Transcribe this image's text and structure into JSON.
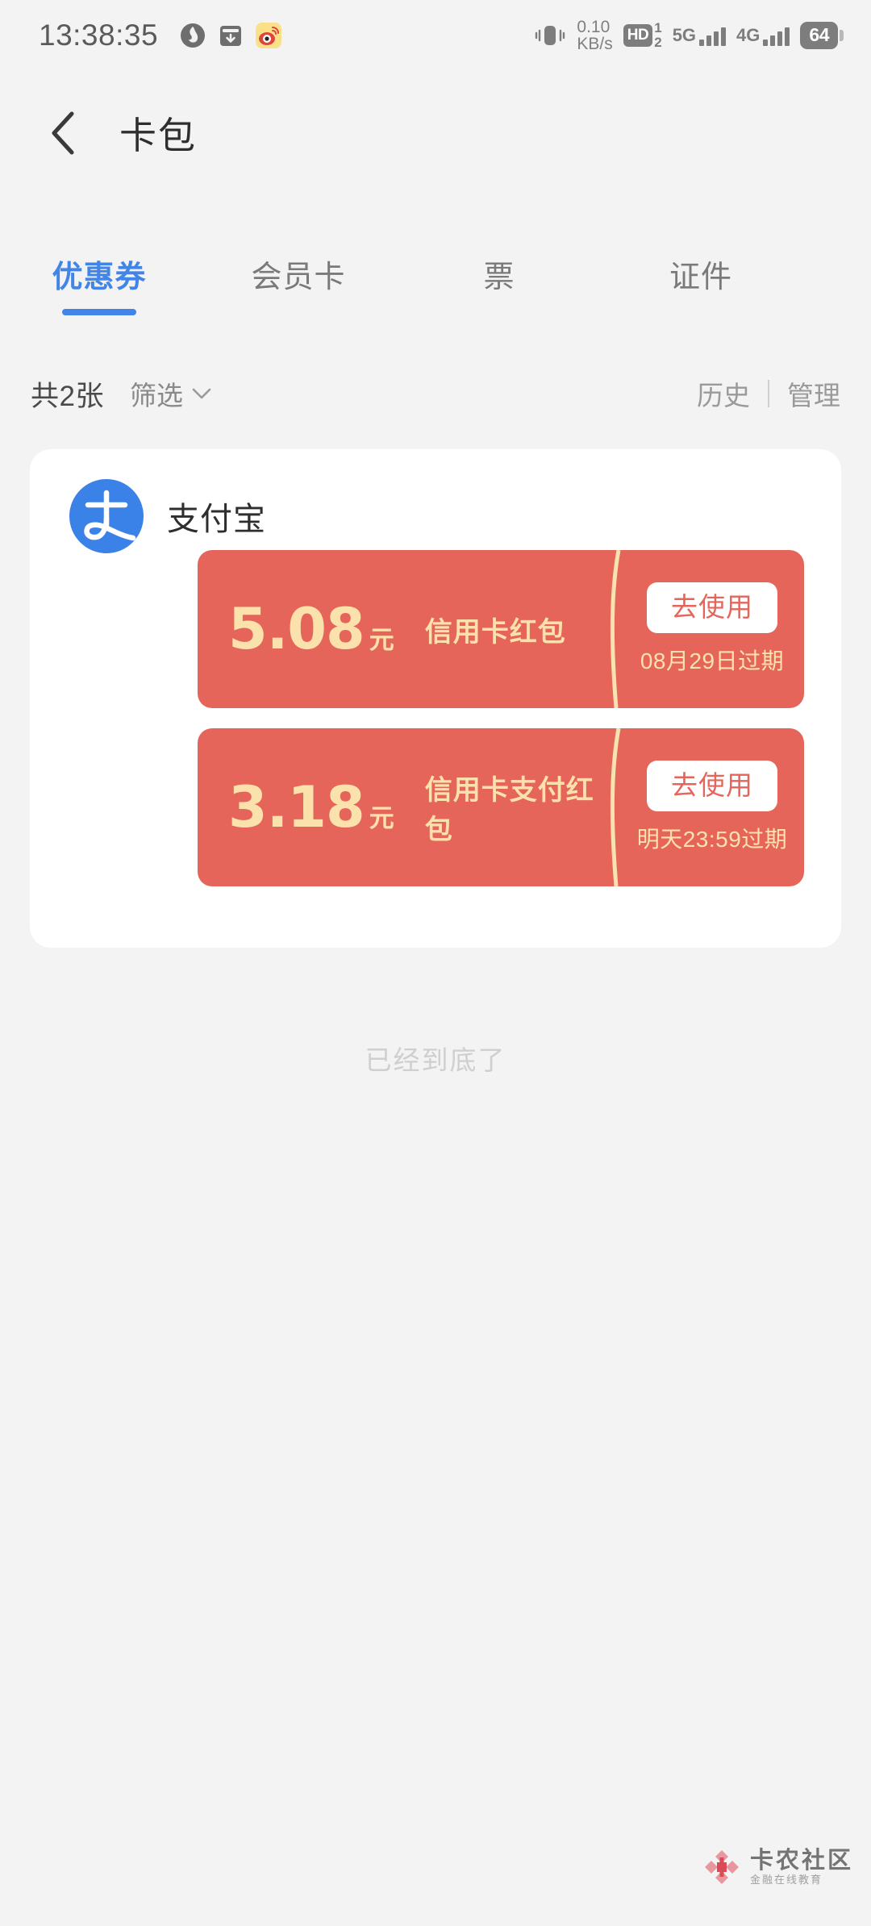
{
  "statusbar": {
    "clock": "13:38:35",
    "app_icons": [
      {
        "name": "flame-app-icon"
      },
      {
        "name": "wallet-download-icon"
      },
      {
        "name": "weibo-app-icon"
      }
    ],
    "vibrate_icon": "vibrate-icon",
    "network_speed_value": "0.10",
    "network_speed_unit": "KB/s",
    "hd_label": "HD",
    "hd_sim_top": "1",
    "hd_sim_bottom": "2",
    "sim1_network": "5G",
    "sim2_network": "4G",
    "battery_level": "64"
  },
  "header": {
    "back_icon": "chevron-left-icon",
    "title": "卡包"
  },
  "tabs": [
    {
      "label": "优惠券",
      "active": true
    },
    {
      "label": "会员卡",
      "active": false
    },
    {
      "label": "票",
      "active": false
    },
    {
      "label": "证件",
      "active": false
    }
  ],
  "filterbar": {
    "count_label": "共2张",
    "filter_label": "筛选",
    "filter_chevron": "chevron-down-icon",
    "history_label": "历史",
    "manage_label": "管理"
  },
  "merchant": {
    "logo_icon": "alipay-logo-icon",
    "name": "支付宝",
    "coupons": [
      {
        "amount": "5.08",
        "unit": "元",
        "title": "信用卡红包",
        "action_label": "去使用",
        "expiry": "08月29日过期"
      },
      {
        "amount": "3.18",
        "unit": "元",
        "title": "信用卡支付红包",
        "action_label": "去使用",
        "expiry": "明天23:59过期"
      }
    ]
  },
  "footer": {
    "end_of_list": "已经到底了"
  },
  "watermark": {
    "logo_icon": "karong-flower-logo-icon",
    "title": "卡农社区",
    "subtitle": "金融在线教育"
  },
  "colors": {
    "accent_blue": "#4285e8",
    "coupon_red": "#e5655a",
    "coupon_gold": "#fbe2ac",
    "page_bg": "#f3f3f3",
    "card_bg": "#ffffff"
  }
}
